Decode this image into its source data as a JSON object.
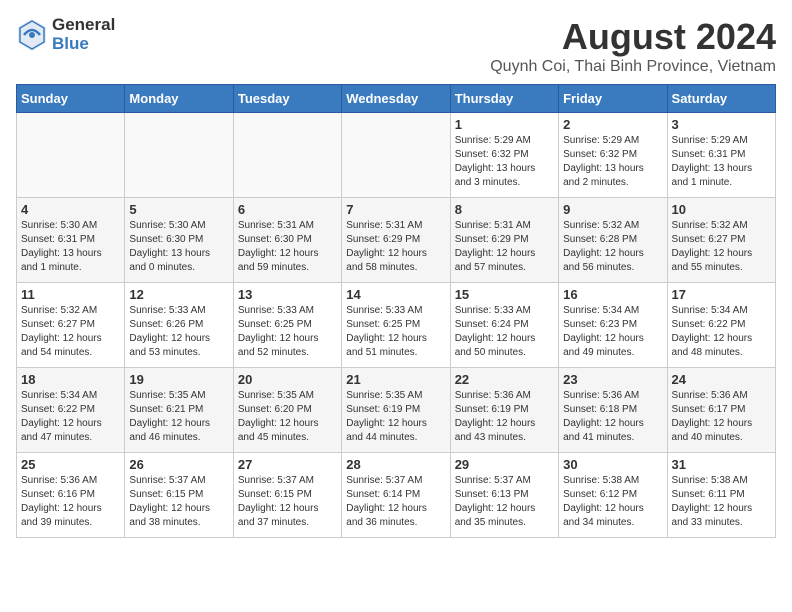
{
  "header": {
    "logo_general": "General",
    "logo_blue": "Blue",
    "main_title": "August 2024",
    "subtitle": "Quynh Coi, Thai Binh Province, Vietnam"
  },
  "calendar": {
    "days_of_week": [
      "Sunday",
      "Monday",
      "Tuesday",
      "Wednesday",
      "Thursday",
      "Friday",
      "Saturday"
    ],
    "weeks": [
      {
        "row_class": "row-even",
        "days": [
          {
            "number": "",
            "empty": true
          },
          {
            "number": "",
            "empty": true
          },
          {
            "number": "",
            "empty": true
          },
          {
            "number": "",
            "empty": true
          },
          {
            "number": "1",
            "sunrise": "5:29 AM",
            "sunset": "6:32 PM",
            "daylight": "13 hours and 3 minutes."
          },
          {
            "number": "2",
            "sunrise": "5:29 AM",
            "sunset": "6:32 PM",
            "daylight": "13 hours and 2 minutes."
          },
          {
            "number": "3",
            "sunrise": "5:29 AM",
            "sunset": "6:31 PM",
            "daylight": "13 hours and 1 minute."
          }
        ]
      },
      {
        "row_class": "row-odd",
        "days": [
          {
            "number": "4",
            "sunrise": "5:30 AM",
            "sunset": "6:31 PM",
            "daylight": "13 hours and 1 minute."
          },
          {
            "number": "5",
            "sunrise": "5:30 AM",
            "sunset": "6:30 PM",
            "daylight": "13 hours and 0 minutes."
          },
          {
            "number": "6",
            "sunrise": "5:31 AM",
            "sunset": "6:30 PM",
            "daylight": "12 hours and 59 minutes."
          },
          {
            "number": "7",
            "sunrise": "5:31 AM",
            "sunset": "6:29 PM",
            "daylight": "12 hours and 58 minutes."
          },
          {
            "number": "8",
            "sunrise": "5:31 AM",
            "sunset": "6:29 PM",
            "daylight": "12 hours and 57 minutes."
          },
          {
            "number": "9",
            "sunrise": "5:32 AM",
            "sunset": "6:28 PM",
            "daylight": "12 hours and 56 minutes."
          },
          {
            "number": "10",
            "sunrise": "5:32 AM",
            "sunset": "6:27 PM",
            "daylight": "12 hours and 55 minutes."
          }
        ]
      },
      {
        "row_class": "row-even",
        "days": [
          {
            "number": "11",
            "sunrise": "5:32 AM",
            "sunset": "6:27 PM",
            "daylight": "12 hours and 54 minutes."
          },
          {
            "number": "12",
            "sunrise": "5:33 AM",
            "sunset": "6:26 PM",
            "daylight": "12 hours and 53 minutes."
          },
          {
            "number": "13",
            "sunrise": "5:33 AM",
            "sunset": "6:25 PM",
            "daylight": "12 hours and 52 minutes."
          },
          {
            "number": "14",
            "sunrise": "5:33 AM",
            "sunset": "6:25 PM",
            "daylight": "12 hours and 51 minutes."
          },
          {
            "number": "15",
            "sunrise": "5:33 AM",
            "sunset": "6:24 PM",
            "daylight": "12 hours and 50 minutes."
          },
          {
            "number": "16",
            "sunrise": "5:34 AM",
            "sunset": "6:23 PM",
            "daylight": "12 hours and 49 minutes."
          },
          {
            "number": "17",
            "sunrise": "5:34 AM",
            "sunset": "6:22 PM",
            "daylight": "12 hours and 48 minutes."
          }
        ]
      },
      {
        "row_class": "row-odd",
        "days": [
          {
            "number": "18",
            "sunrise": "5:34 AM",
            "sunset": "6:22 PM",
            "daylight": "12 hours and 47 minutes."
          },
          {
            "number": "19",
            "sunrise": "5:35 AM",
            "sunset": "6:21 PM",
            "daylight": "12 hours and 46 minutes."
          },
          {
            "number": "20",
            "sunrise": "5:35 AM",
            "sunset": "6:20 PM",
            "daylight": "12 hours and 45 minutes."
          },
          {
            "number": "21",
            "sunrise": "5:35 AM",
            "sunset": "6:19 PM",
            "daylight": "12 hours and 44 minutes."
          },
          {
            "number": "22",
            "sunrise": "5:36 AM",
            "sunset": "6:19 PM",
            "daylight": "12 hours and 43 minutes."
          },
          {
            "number": "23",
            "sunrise": "5:36 AM",
            "sunset": "6:18 PM",
            "daylight": "12 hours and 41 minutes."
          },
          {
            "number": "24",
            "sunrise": "5:36 AM",
            "sunset": "6:17 PM",
            "daylight": "12 hours and 40 minutes."
          }
        ]
      },
      {
        "row_class": "row-even",
        "days": [
          {
            "number": "25",
            "sunrise": "5:36 AM",
            "sunset": "6:16 PM",
            "daylight": "12 hours and 39 minutes."
          },
          {
            "number": "26",
            "sunrise": "5:37 AM",
            "sunset": "6:15 PM",
            "daylight": "12 hours and 38 minutes."
          },
          {
            "number": "27",
            "sunrise": "5:37 AM",
            "sunset": "6:15 PM",
            "daylight": "12 hours and 37 minutes."
          },
          {
            "number": "28",
            "sunrise": "5:37 AM",
            "sunset": "6:14 PM",
            "daylight": "12 hours and 36 minutes."
          },
          {
            "number": "29",
            "sunrise": "5:37 AM",
            "sunset": "6:13 PM",
            "daylight": "12 hours and 35 minutes."
          },
          {
            "number": "30",
            "sunrise": "5:38 AM",
            "sunset": "6:12 PM",
            "daylight": "12 hours and 34 minutes."
          },
          {
            "number": "31",
            "sunrise": "5:38 AM",
            "sunset": "6:11 PM",
            "daylight": "12 hours and 33 minutes."
          }
        ]
      }
    ]
  }
}
